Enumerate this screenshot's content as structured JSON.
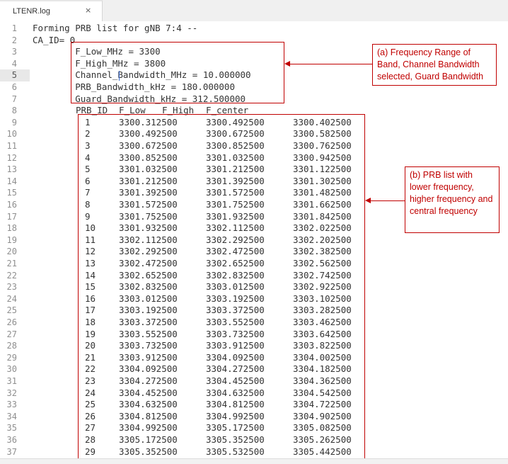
{
  "tab": {
    "title": "LTENR.log",
    "close": "×"
  },
  "cursor_line": 5,
  "lines": [
    {
      "n": "1",
      "text": "Forming PRB list for gNB 7:4 --"
    },
    {
      "n": "2",
      "text": "CA_ID= 0"
    },
    {
      "n": "3",
      "text": "        F_Low_MHz = 3300"
    },
    {
      "n": "4",
      "text": "        F_High_MHz = 3800"
    },
    {
      "n": "5",
      "text": "        Channel_Bandwidth_MHz = 10.000000"
    },
    {
      "n": "6",
      "text": "        PRB_Bandwidth_kHz = 180.000000"
    },
    {
      "n": "7",
      "text": "        Guard_Bandwidth_kHz = 312.500000"
    }
  ],
  "table_header": {
    "n": "8",
    "cols": [
      "PRB_ID",
      "F_Low",
      "F_High",
      "F_center"
    ]
  },
  "prb_rows": [
    {
      "n": "9",
      "id": "1",
      "low": "3300.312500",
      "high": "3300.492500",
      "center": "3300.402500"
    },
    {
      "n": "10",
      "id": "2",
      "low": "3300.492500",
      "high": "3300.672500",
      "center": "3300.582500"
    },
    {
      "n": "11",
      "id": "3",
      "low": "3300.672500",
      "high": "3300.852500",
      "center": "3300.762500"
    },
    {
      "n": "12",
      "id": "4",
      "low": "3300.852500",
      "high": "3301.032500",
      "center": "3300.942500"
    },
    {
      "n": "13",
      "id": "5",
      "low": "3301.032500",
      "high": "3301.212500",
      "center": "3301.122500"
    },
    {
      "n": "14",
      "id": "6",
      "low": "3301.212500",
      "high": "3301.392500",
      "center": "3301.302500"
    },
    {
      "n": "15",
      "id": "7",
      "low": "3301.392500",
      "high": "3301.572500",
      "center": "3301.482500"
    },
    {
      "n": "16",
      "id": "8",
      "low": "3301.572500",
      "high": "3301.752500",
      "center": "3301.662500"
    },
    {
      "n": "17",
      "id": "9",
      "low": "3301.752500",
      "high": "3301.932500",
      "center": "3301.842500"
    },
    {
      "n": "18",
      "id": "10",
      "low": "3301.932500",
      "high": "3302.112500",
      "center": "3302.022500"
    },
    {
      "n": "19",
      "id": "11",
      "low": "3302.112500",
      "high": "3302.292500",
      "center": "3302.202500"
    },
    {
      "n": "20",
      "id": "12",
      "low": "3302.292500",
      "high": "3302.472500",
      "center": "3302.382500"
    },
    {
      "n": "21",
      "id": "13",
      "low": "3302.472500",
      "high": "3302.652500",
      "center": "3302.562500"
    },
    {
      "n": "22",
      "id": "14",
      "low": "3302.652500",
      "high": "3302.832500",
      "center": "3302.742500"
    },
    {
      "n": "23",
      "id": "15",
      "low": "3302.832500",
      "high": "3303.012500",
      "center": "3302.922500"
    },
    {
      "n": "24",
      "id": "16",
      "low": "3303.012500",
      "high": "3303.192500",
      "center": "3303.102500"
    },
    {
      "n": "25",
      "id": "17",
      "low": "3303.192500",
      "high": "3303.372500",
      "center": "3303.282500"
    },
    {
      "n": "26",
      "id": "18",
      "low": "3303.372500",
      "high": "3303.552500",
      "center": "3303.462500"
    },
    {
      "n": "27",
      "id": "19",
      "low": "3303.552500",
      "high": "3303.732500",
      "center": "3303.642500"
    },
    {
      "n": "28",
      "id": "20",
      "low": "3303.732500",
      "high": "3303.912500",
      "center": "3303.822500"
    },
    {
      "n": "29",
      "id": "21",
      "low": "3303.912500",
      "high": "3304.092500",
      "center": "3304.002500"
    },
    {
      "n": "30",
      "id": "22",
      "low": "3304.092500",
      "high": "3304.272500",
      "center": "3304.182500"
    },
    {
      "n": "31",
      "id": "23",
      "low": "3304.272500",
      "high": "3304.452500",
      "center": "3304.362500"
    },
    {
      "n": "32",
      "id": "24",
      "low": "3304.452500",
      "high": "3304.632500",
      "center": "3304.542500"
    },
    {
      "n": "33",
      "id": "25",
      "low": "3304.632500",
      "high": "3304.812500",
      "center": "3304.722500"
    },
    {
      "n": "34",
      "id": "26",
      "low": "3304.812500",
      "high": "3304.992500",
      "center": "3304.902500"
    },
    {
      "n": "35",
      "id": "27",
      "low": "3304.992500",
      "high": "3305.172500",
      "center": "3305.082500"
    },
    {
      "n": "36",
      "id": "28",
      "low": "3305.172500",
      "high": "3305.352500",
      "center": "3305.262500"
    },
    {
      "n": "37",
      "id": "29",
      "low": "3305.352500",
      "high": "3305.532500",
      "center": "3305.442500"
    }
  ],
  "annotations": {
    "a": "(a) Frequency Range of Band, Channel Bandwidth selected, Guard Bandwidth",
    "b": "(b) PRB list with lower frequency, higher frequency and central frequency"
  },
  "colors": {
    "annotation": "#c00000",
    "line_numbers": "#8f8f8f",
    "text": "#333333"
  }
}
